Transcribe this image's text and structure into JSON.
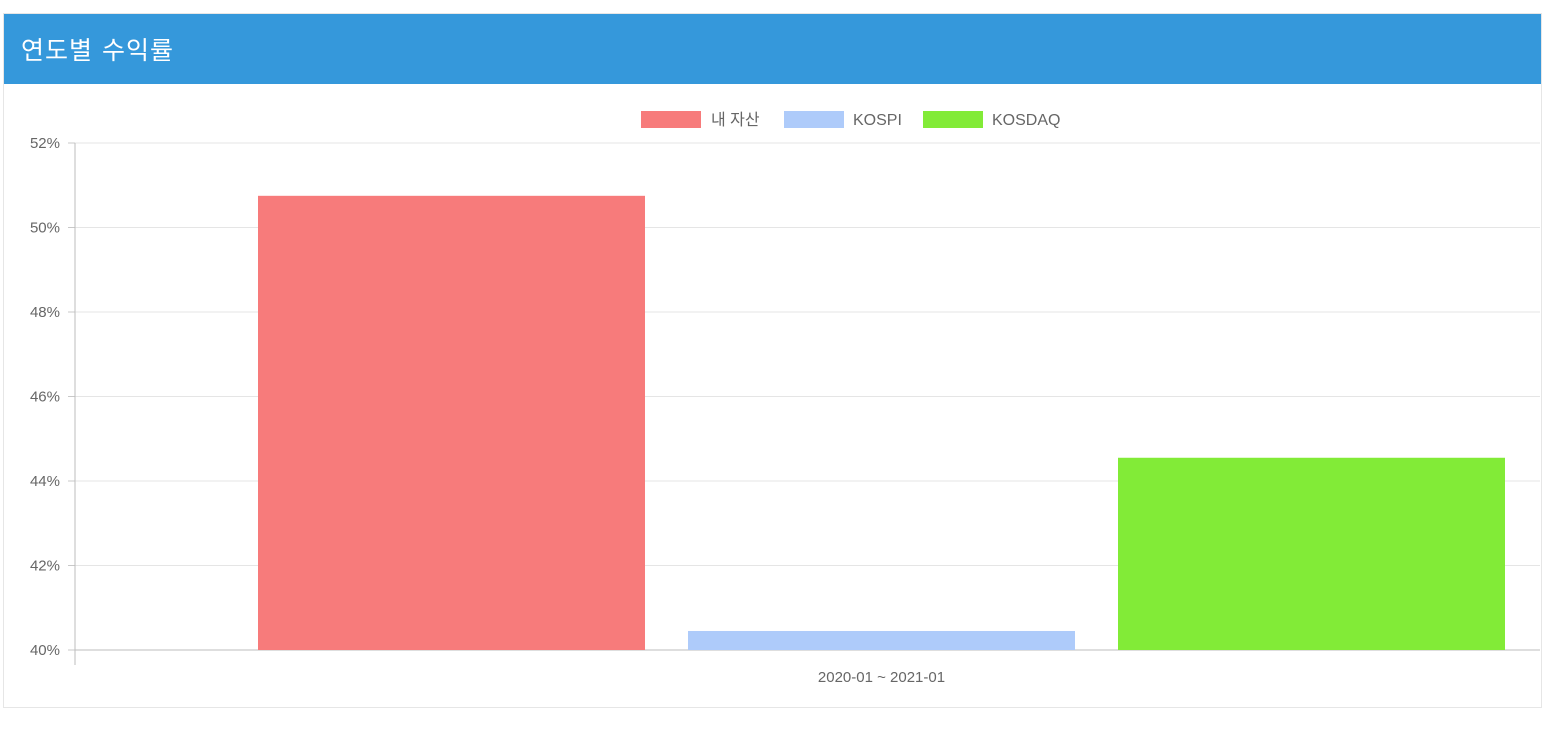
{
  "panel": {
    "title": "연도별 수익률",
    "header_color": "#3598db"
  },
  "chart_data": {
    "type": "bar",
    "categories": [
      "2020-01 ~ 2021-01"
    ],
    "series": [
      {
        "name": "내 자산",
        "values": [
          50.75
        ],
        "color": "#f77b7b"
      },
      {
        "name": "KOSPI",
        "values": [
          40.45
        ],
        "color": "#aecbfa"
      },
      {
        "name": "KOSDAQ",
        "values": [
          44.55
        ],
        "color": "#82eb37"
      }
    ],
    "ylim": [
      40,
      52
    ],
    "yticks": [
      "40%",
      "42%",
      "44%",
      "46%",
      "48%",
      "50%",
      "52%"
    ],
    "ytick_values": [
      40,
      42,
      44,
      46,
      48,
      50,
      52
    ],
    "grid": true,
    "legend_position": "top"
  }
}
